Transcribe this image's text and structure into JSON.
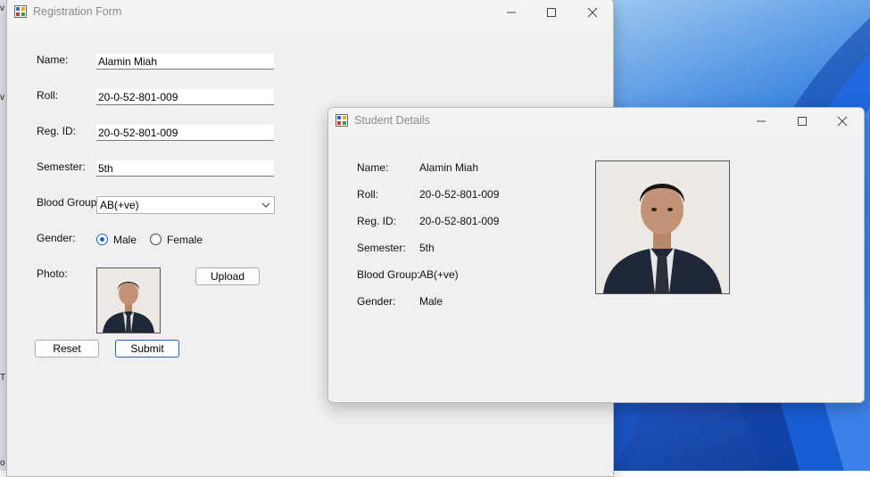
{
  "registration_form": {
    "title": "Registration Form",
    "labels": {
      "name": "Name:",
      "roll": "Roll:",
      "reg_id": "Reg. ID:",
      "semester": "Semester:",
      "blood_group": "Blood Group:",
      "gender": "Gender:",
      "photo": "Photo:"
    },
    "values": {
      "name": "Alamin Miah",
      "roll": "20-0-52-801-009",
      "reg_id": "20-0-52-801-009",
      "semester": "5th",
      "blood_group": "AB(+ve)"
    },
    "gender_options": [
      "Male",
      "Female"
    ],
    "gender_selected": "Male",
    "buttons": {
      "upload": "Upload",
      "reset": "Reset",
      "submit": "Submit"
    }
  },
  "student_details": {
    "title": "Student Details",
    "labels": {
      "name": "Name:",
      "roll": "Roll:",
      "reg_id": "Reg. ID:",
      "semester": "Semester:",
      "blood_group": "Blood Group:",
      "gender": "Gender:"
    },
    "values": {
      "name": "Alamin Miah",
      "roll": "20-0-52-801-009",
      "reg_id": "20-0-52-801-009",
      "semester": "5th",
      "blood_group": "AB(+ve)",
      "gender": "Male"
    }
  },
  "icons": {
    "app": "winforms-app-icon",
    "minimize": "minimize-icon",
    "maximize": "maximize-icon",
    "close": "close-icon",
    "dropdown": "chevron-down-icon"
  },
  "colors": {
    "accent": "#1a63c7",
    "window_bg": "#f0f0f0"
  }
}
